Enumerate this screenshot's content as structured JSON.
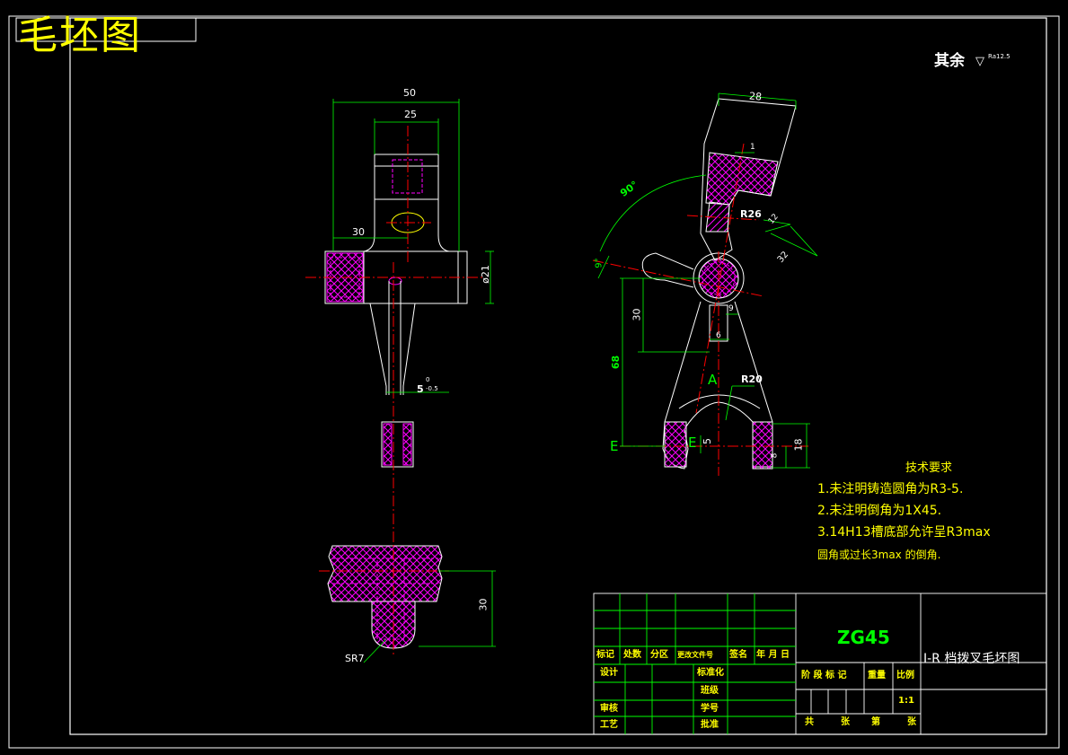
{
  "title": "毛坯图",
  "surface_note": {
    "label": "其余",
    "roughness": "Ra12.5"
  },
  "requirements": {
    "heading": "技术要求",
    "items": [
      "1.未注明铸造圆角为R3-5.",
      "2.未注明倒角为1X45.",
      "3.14H13槽底部允许呈R3max",
      "圆角或过长3max 的倒角."
    ]
  },
  "title_block": {
    "material": "ZG45",
    "drawing_name": "I-R 档拨叉毛坯图",
    "revision_headers": [
      "标记",
      "处数",
      "分区",
      "更改文件号",
      "签名",
      "年 月 日"
    ],
    "rows": {
      "design": "设计",
      "standard": "标准化",
      "class": "班级",
      "review": "审核",
      "student_id": "学号",
      "process": "工艺",
      "approve": "批准"
    },
    "stage_headers": [
      "阶 段 标 记",
      "重量",
      "比例"
    ],
    "scale": "1:1",
    "sheet": [
      "共",
      "张",
      "第",
      "张"
    ]
  },
  "dimensions": {
    "left_view": {
      "width_50": "50",
      "width_25": "25",
      "offset_30": "30",
      "dia_21": "ø21",
      "slot": "5",
      "slot_tol_upper": "0",
      "slot_tol_lower": "-0.5",
      "height_30": "30",
      "sphere": "SR7"
    },
    "right_view": {
      "width_28": "28",
      "gap_1": "1",
      "angle_90": "90°",
      "radius_26": "R26",
      "len_12": "12",
      "len_32": "32",
      "angle_9": "9°",
      "h_30": "30",
      "h_68": "68",
      "w_9": "9",
      "w_6": "6",
      "section_a": "A",
      "radius_20": "R20",
      "section_e_left": "E",
      "section_e_right": "E",
      "w_5": "5",
      "h_18": "18",
      "h_8": "8"
    }
  }
}
